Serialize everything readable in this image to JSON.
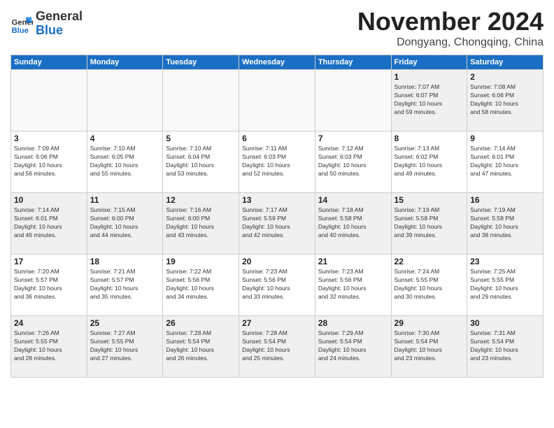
{
  "header": {
    "logo": {
      "general": "General",
      "blue": "Blue"
    },
    "title": "November 2024",
    "location": "Dongyang, Chongqing, China"
  },
  "days_of_week": [
    "Sunday",
    "Monday",
    "Tuesday",
    "Wednesday",
    "Thursday",
    "Friday",
    "Saturday"
  ],
  "weeks": [
    [
      {
        "day": "",
        "info": "",
        "empty": true
      },
      {
        "day": "",
        "info": "",
        "empty": true
      },
      {
        "day": "",
        "info": "",
        "empty": true
      },
      {
        "day": "",
        "info": "",
        "empty": true
      },
      {
        "day": "",
        "info": "",
        "empty": true
      },
      {
        "day": "1",
        "info": "Sunrise: 7:07 AM\nSunset: 6:07 PM\nDaylight: 10 hours\nand 59 minutes."
      },
      {
        "day": "2",
        "info": "Sunrise: 7:08 AM\nSunset: 6:06 PM\nDaylight: 10 hours\nand 58 minutes."
      }
    ],
    [
      {
        "day": "3",
        "info": "Sunrise: 7:09 AM\nSunset: 6:06 PM\nDaylight: 10 hours\nand 56 minutes."
      },
      {
        "day": "4",
        "info": "Sunrise: 7:10 AM\nSunset: 6:05 PM\nDaylight: 10 hours\nand 55 minutes."
      },
      {
        "day": "5",
        "info": "Sunrise: 7:10 AM\nSunset: 6:04 PM\nDaylight: 10 hours\nand 53 minutes."
      },
      {
        "day": "6",
        "info": "Sunrise: 7:11 AM\nSunset: 6:03 PM\nDaylight: 10 hours\nand 52 minutes."
      },
      {
        "day": "7",
        "info": "Sunrise: 7:12 AM\nSunset: 6:03 PM\nDaylight: 10 hours\nand 50 minutes."
      },
      {
        "day": "8",
        "info": "Sunrise: 7:13 AM\nSunset: 6:02 PM\nDaylight: 10 hours\nand 49 minutes."
      },
      {
        "day": "9",
        "info": "Sunrise: 7:14 AM\nSunset: 6:01 PM\nDaylight: 10 hours\nand 47 minutes."
      }
    ],
    [
      {
        "day": "10",
        "info": "Sunrise: 7:14 AM\nSunset: 6:01 PM\nDaylight: 10 hours\nand 46 minutes."
      },
      {
        "day": "11",
        "info": "Sunrise: 7:15 AM\nSunset: 6:00 PM\nDaylight: 10 hours\nand 44 minutes."
      },
      {
        "day": "12",
        "info": "Sunrise: 7:16 AM\nSunset: 6:00 PM\nDaylight: 10 hours\nand 43 minutes."
      },
      {
        "day": "13",
        "info": "Sunrise: 7:17 AM\nSunset: 5:59 PM\nDaylight: 10 hours\nand 42 minutes."
      },
      {
        "day": "14",
        "info": "Sunrise: 7:18 AM\nSunset: 5:58 PM\nDaylight: 10 hours\nand 40 minutes."
      },
      {
        "day": "15",
        "info": "Sunrise: 7:19 AM\nSunset: 5:58 PM\nDaylight: 10 hours\nand 39 minutes."
      },
      {
        "day": "16",
        "info": "Sunrise: 7:19 AM\nSunset: 5:58 PM\nDaylight: 10 hours\nand 38 minutes."
      }
    ],
    [
      {
        "day": "17",
        "info": "Sunrise: 7:20 AM\nSunset: 5:57 PM\nDaylight: 10 hours\nand 36 minutes."
      },
      {
        "day": "18",
        "info": "Sunrise: 7:21 AM\nSunset: 5:57 PM\nDaylight: 10 hours\nand 35 minutes."
      },
      {
        "day": "19",
        "info": "Sunrise: 7:22 AM\nSunset: 5:56 PM\nDaylight: 10 hours\nand 34 minutes."
      },
      {
        "day": "20",
        "info": "Sunrise: 7:23 AM\nSunset: 5:56 PM\nDaylight: 10 hours\nand 33 minutes."
      },
      {
        "day": "21",
        "info": "Sunrise: 7:23 AM\nSunset: 5:56 PM\nDaylight: 10 hours\nand 32 minutes."
      },
      {
        "day": "22",
        "info": "Sunrise: 7:24 AM\nSunset: 5:55 PM\nDaylight: 10 hours\nand 30 minutes."
      },
      {
        "day": "23",
        "info": "Sunrise: 7:25 AM\nSunset: 5:55 PM\nDaylight: 10 hours\nand 29 minutes."
      }
    ],
    [
      {
        "day": "24",
        "info": "Sunrise: 7:26 AM\nSunset: 5:55 PM\nDaylight: 10 hours\nand 28 minutes."
      },
      {
        "day": "25",
        "info": "Sunrise: 7:27 AM\nSunset: 5:55 PM\nDaylight: 10 hours\nand 27 minutes."
      },
      {
        "day": "26",
        "info": "Sunrise: 7:28 AM\nSunset: 5:54 PM\nDaylight: 10 hours\nand 26 minutes."
      },
      {
        "day": "27",
        "info": "Sunrise: 7:28 AM\nSunset: 5:54 PM\nDaylight: 10 hours\nand 25 minutes."
      },
      {
        "day": "28",
        "info": "Sunrise: 7:29 AM\nSunset: 5:54 PM\nDaylight: 10 hours\nand 24 minutes."
      },
      {
        "day": "29",
        "info": "Sunrise: 7:30 AM\nSunset: 5:54 PM\nDaylight: 10 hours\nand 23 minutes."
      },
      {
        "day": "30",
        "info": "Sunrise: 7:31 AM\nSunset: 5:54 PM\nDaylight: 10 hours\nand 23 minutes."
      }
    ]
  ]
}
